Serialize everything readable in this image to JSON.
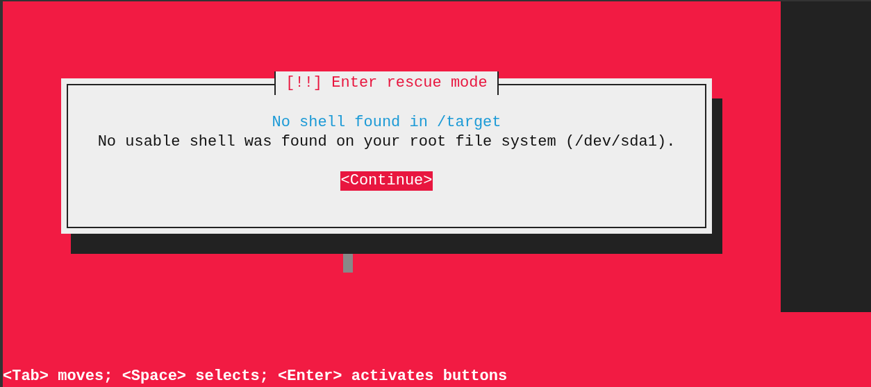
{
  "dialog": {
    "title": "[!!] Enter rescue mode",
    "heading": "No shell found in /target",
    "message": "No usable shell was found on your root file system (/dev/sda1).",
    "buttons": [
      {
        "label": "<Continue>",
        "selected": true
      }
    ]
  },
  "help_line": "<Tab> moves; <Space> selects; <Enter> activates buttons"
}
